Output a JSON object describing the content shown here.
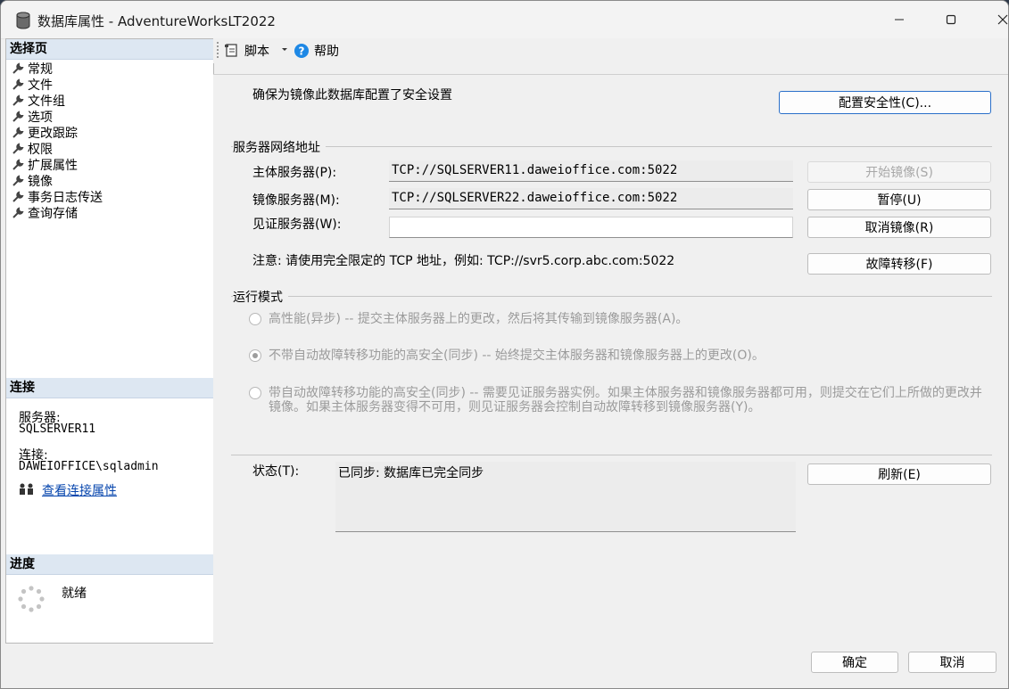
{
  "window": {
    "title": "数据库属性 - AdventureWorksLT2022"
  },
  "left_pane": {
    "select_page_header": "选择页",
    "pages": [
      {
        "label": "常规"
      },
      {
        "label": "文件"
      },
      {
        "label": "文件组"
      },
      {
        "label": "选项"
      },
      {
        "label": "更改跟踪"
      },
      {
        "label": "权限"
      },
      {
        "label": "扩展属性"
      },
      {
        "label": "镜像"
      },
      {
        "label": "事务日志传送"
      },
      {
        "label": "查询存储"
      }
    ],
    "connection_header": "连接",
    "server_label": "服务器:",
    "server_value": "SQLSERVER11",
    "connection_label": "连接:",
    "connection_value": "DAWEIOFFICE\\sqladmin",
    "view_connection_link": "查看连接属性",
    "progress_header": "进度",
    "progress_status": "就绪"
  },
  "toolbar": {
    "script_label": "脚本",
    "help_label": "帮助"
  },
  "mirroring": {
    "security_note": "确保为镜像此数据库配置了安全设置",
    "configure_security_button": "配置安全性(C)...",
    "network_group_label": "服务器网络地址",
    "principal_label": "主体服务器(P):",
    "principal_value": "TCP://SQLSERVER11.daweioffice.com:5022",
    "mirror_label": "镜像服务器(M):",
    "mirror_value": "TCP://SQLSERVER22.daweioffice.com:5022",
    "witness_label": "见证服务器(W):",
    "witness_value": "",
    "start_mirroring_button": "开始镜像(S)",
    "pause_button": "暂停(U)",
    "remove_mirroring_button": "取消镜像(R)",
    "failover_button": "故障转移(F)",
    "address_note": "注意: 请使用完全限定的 TCP 地址，例如: TCP://svr5.corp.abc.com:5022",
    "operating_mode_label": "运行模式",
    "modes": [
      {
        "label": "高性能(异步) -- 提交主体服务器上的更改，然后将其传输到镜像服务器(A)。",
        "checked": false
      },
      {
        "label": "不带自动故障转移功能的高安全(同步) -- 始终提交主体服务器和镜像服务器上的更改(O)。",
        "checked": true
      },
      {
        "label": "带自动故障转移功能的高安全(同步) -- 需要见证服务器实例。如果主体服务器和镜像服务器都可用，则提交在它们上所做的更改并镜像。如果主体服务器变得不可用，则见证服务器会控制自动故障转移到镜像服务器(Y)。",
        "checked": false
      }
    ],
    "status_label": "状态(T):",
    "status_value": "已同步: 数据库已完全同步",
    "refresh_button": "刷新(E)"
  },
  "footer": {
    "ok_button": "确定",
    "cancel_button": "取消"
  }
}
